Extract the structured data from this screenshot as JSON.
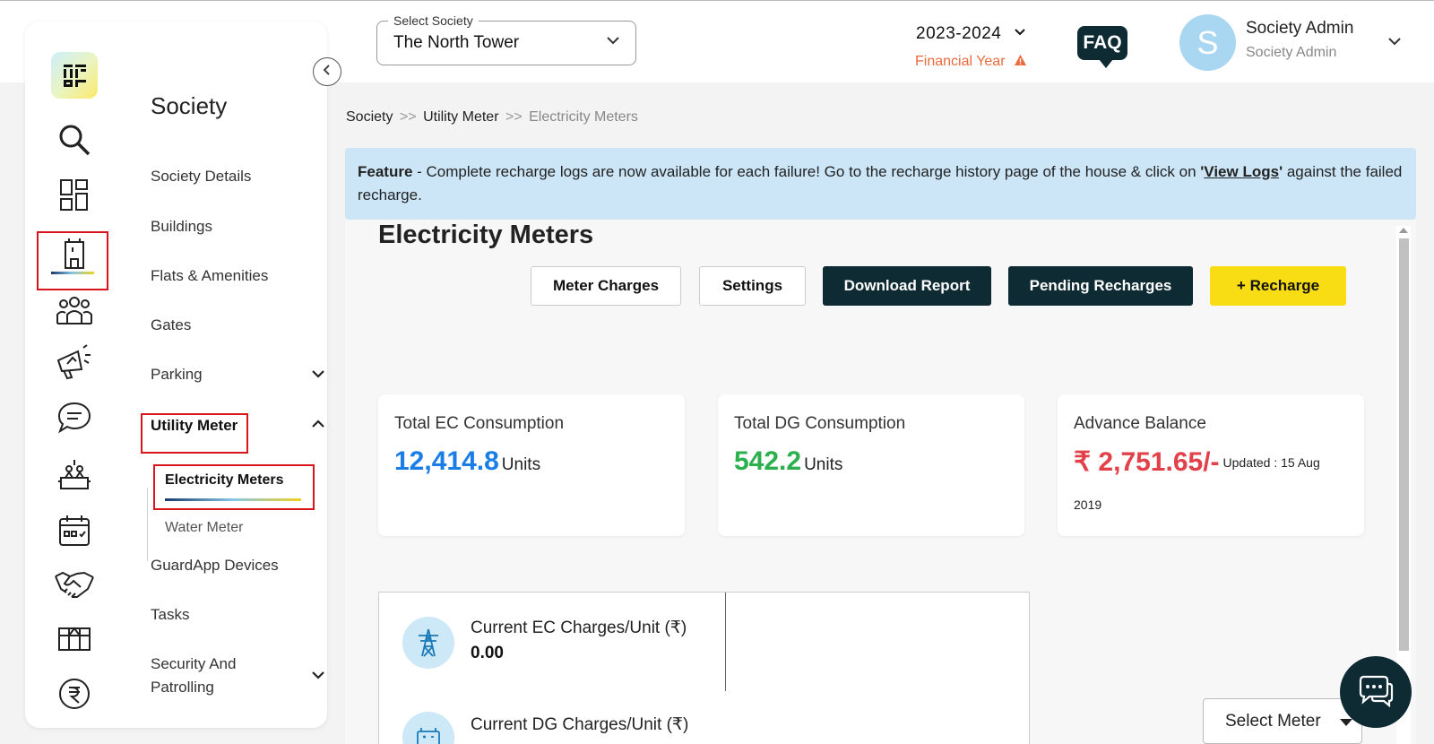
{
  "header": {
    "society_select_label": "Select Society",
    "society_select_value": "The North Tower",
    "financial_year_value": "2023-2024",
    "financial_year_label": "Financial Year",
    "faq_label": "FAQ",
    "avatar_letter": "S",
    "user_name": "Society Admin",
    "user_role": "Society Admin"
  },
  "sidebar": {
    "title": "Society",
    "items": [
      {
        "label": "Society Details"
      },
      {
        "label": "Buildings"
      },
      {
        "label": "Flats & Amenities"
      },
      {
        "label": "Gates"
      },
      {
        "label": "Parking"
      },
      {
        "label": "Utility Meter"
      },
      {
        "label": "GuardApp Devices"
      },
      {
        "label": "Tasks"
      },
      {
        "label": "Security And"
      },
      {
        "label": "Patrolling"
      }
    ],
    "sub_items": [
      {
        "label": "Electricity Meters"
      },
      {
        "label": "Water Meter"
      }
    ],
    "rail_icons": [
      "search-icon",
      "dashboard-icon",
      "building-icon",
      "residents-icon",
      "announcement-icon",
      "chat-icon",
      "amenity-icon",
      "calendar-icon",
      "handshake-icon",
      "box-icon",
      "rupee-icon"
    ]
  },
  "breadcrumb": {
    "part1": "Society",
    "sep1": ">>",
    "part2": "Utility Meter",
    "sep2": ">>",
    "current": "Electricity Meters"
  },
  "banner": {
    "bold": "Feature",
    "text": " - Complete recharge logs are now available for each failure! Go to the recharge history page of the house & click on ",
    "quote_open": "'",
    "link": "View Logs",
    "quote_close": "'",
    "text2": " against the failed recharge."
  },
  "main": {
    "title": "Electricity Meters",
    "buttons": {
      "meter_charges": "Meter Charges",
      "settings": "Settings",
      "download_report": "Download Report",
      "pending_recharges": "Pending Recharges",
      "recharge": "+ Recharge"
    },
    "cards": {
      "ec_title": "Total EC Consumption",
      "ec_value": "12,414.8",
      "ec_unit": "Units",
      "dg_title": "Total DG Consumption",
      "dg_value": "542.2",
      "dg_unit": "Units",
      "adv_title": "Advance Balance",
      "adv_value": "₹ 2,751.65/-",
      "adv_updated": "Updated : 15 Aug",
      "adv_updated2": "2019"
    },
    "charges": {
      "ec_label": "Current EC Charges/Unit (₹)",
      "ec_value": "0.00",
      "dg_label": "Current DG Charges/Unit (₹)"
    },
    "select_meter": "Select Meter"
  },
  "colors": {
    "dark": "#0e2a33",
    "yellow": "#f8dc14",
    "ec_blue": "#1a7ee6",
    "dg_green": "#2bb04d",
    "balance_red": "#e2414a",
    "warning_orange": "#ea6a3c",
    "highlight_red": "#d9141b",
    "banner_blue": "#cce6f7"
  }
}
